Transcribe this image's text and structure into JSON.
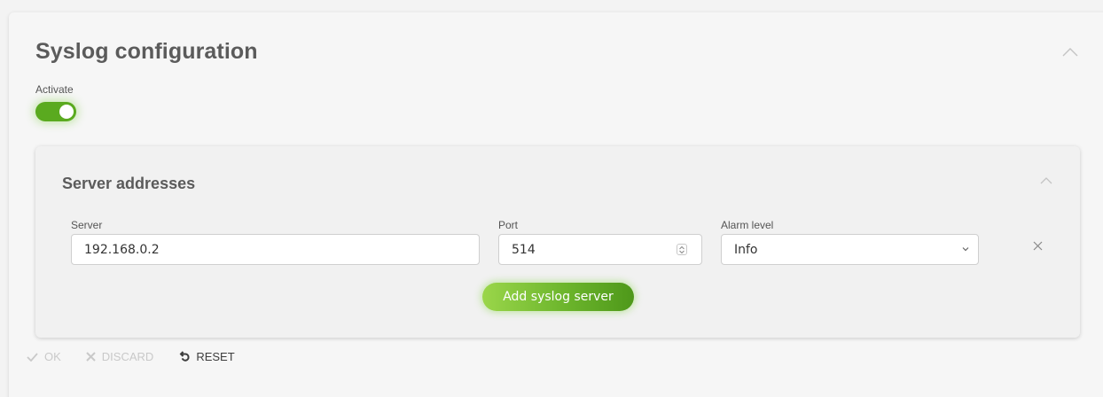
{
  "section": {
    "title": "Syslog configuration",
    "collapse_icon": "chevron-up-icon"
  },
  "activate": {
    "label": "Activate",
    "enabled": true,
    "color": "#5aaa1f"
  },
  "server_addresses": {
    "title": "Server addresses",
    "collapse_icon": "chevron-up-icon",
    "fields": {
      "server_label": "Server",
      "port_label": "Port",
      "alarm_label": "Alarm level"
    },
    "rows": [
      {
        "server": "192.168.0.2",
        "port": "514",
        "alarm_level": "Info"
      }
    ],
    "add_button": "Add syslog server",
    "remove_icon": "close-icon",
    "accent": "#6cb52c"
  },
  "footer": {
    "ok": "OK",
    "discard": "DISCARD",
    "reset": "RESET"
  }
}
